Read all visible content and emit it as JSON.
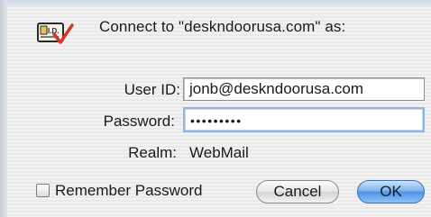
{
  "dialog": {
    "title": "Connect to \"deskndoorusa.com\" as:",
    "icon": "id-card-check-icon"
  },
  "form": {
    "user_id_label": "User ID:",
    "user_id_value": "jonb@deskndoorusa.com",
    "password_label": "Password:",
    "password_value": "•••••••••",
    "realm_label": "Realm:",
    "realm_value": "WebMail"
  },
  "options": {
    "remember_label": "Remember Password"
  },
  "buttons": {
    "cancel": "Cancel",
    "ok": "OK"
  },
  "colors": {
    "ok_button": "#4f92e6",
    "focus_ring": "#8fb5e0",
    "check_mark": "#d23a2a"
  }
}
